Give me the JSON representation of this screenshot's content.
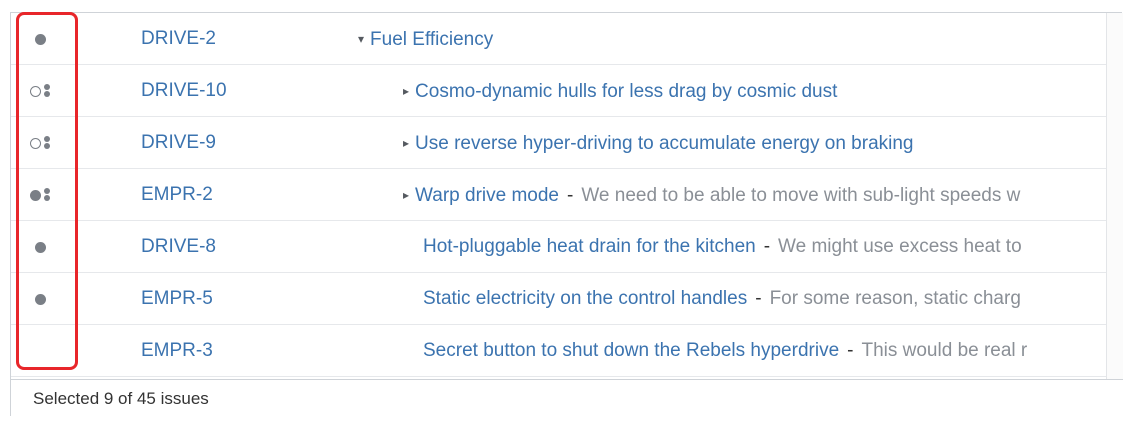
{
  "rows": [
    {
      "status": "filled",
      "key": "DRIVE-2",
      "toggle": "▾",
      "summary": "Fuel Efficiency",
      "description": ""
    },
    {
      "status": "hollow-multi",
      "key": "DRIVE-10",
      "toggle": "▸",
      "summary": "Cosmo-dynamic hulls for less drag by cosmic dust",
      "description": ""
    },
    {
      "status": "hollow-multi",
      "key": "DRIVE-9",
      "toggle": "▸",
      "summary": "Use reverse hyper-driving to accumulate energy on braking",
      "description": ""
    },
    {
      "status": "filled-multi",
      "key": "EMPR-2",
      "toggle": "▸",
      "summary": "Warp drive mode",
      "separator": "-",
      "description": "We need to be able to move with sub-light speeds w"
    },
    {
      "status": "filled",
      "key": "DRIVE-8",
      "toggle": "",
      "summary": "Hot-pluggable heat drain for the kitchen",
      "separator": "-",
      "description": "We might use excess heat to"
    },
    {
      "status": "filled",
      "key": "EMPR-5",
      "toggle": "",
      "summary": "Static electricity on the control handles",
      "separator": "-",
      "description": "For some reason, static charg"
    },
    {
      "status": "none",
      "key": "EMPR-3",
      "toggle": "",
      "summary": "Secret button to shut down the Rebels hyperdrive",
      "separator": "-",
      "description": "This would be real r"
    }
  ],
  "footer": {
    "selection_text": "Selected 9 of 45 issues"
  },
  "colors": {
    "link": "#3b73af",
    "description": "#8a8f96",
    "status_dot": "#7a7f86",
    "highlight": "#e8262a"
  },
  "icons": {
    "filled": "status-dot-filled-icon",
    "hollow-multi": "status-dot-hollow-multi-icon",
    "filled-multi": "status-dot-filled-multi-icon"
  }
}
